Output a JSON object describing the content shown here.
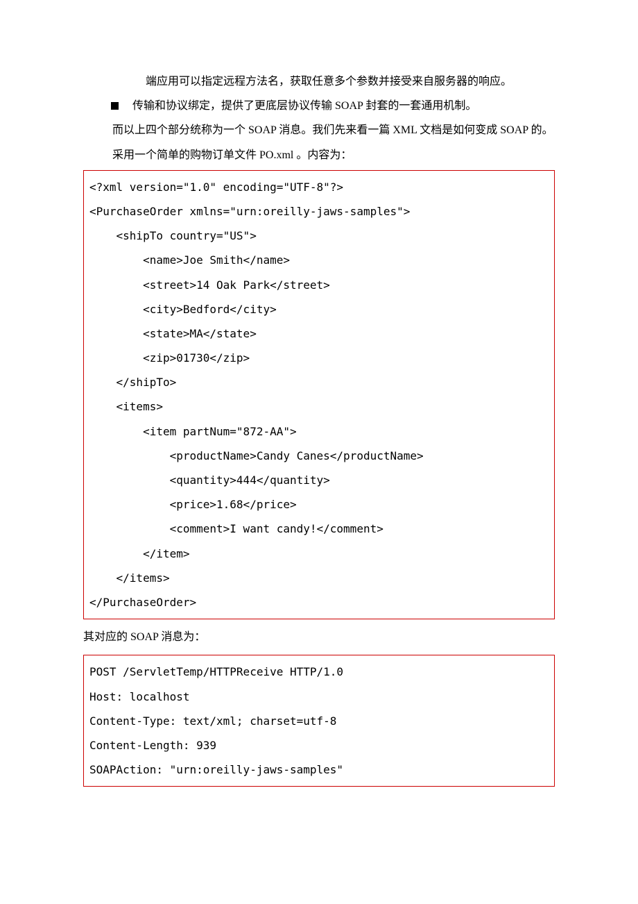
{
  "intro_cont": "端应用可以指定远程方法名，获取任意多个参数并接受来自服务器的响应。",
  "bullet": "传输和协议绑定，提供了更底层协议传输 SOAP 封套的一套通用机制。",
  "para_after_bullet": "而以上四个部分统称为一个 SOAP 消息。我们先来看一篇 XML 文档是如何变成 SOAP 的。采用一个简单的购物订单文件 PO.xml 。内容为：",
  "code1": "<?xml version=\"1.0\" encoding=\"UTF-8\"?>\n<PurchaseOrder xmlns=\"urn:oreilly-jaws-samples\">\n    <shipTo country=\"US\">\n        <name>Joe Smith</name>\n        <street>14 Oak Park</street>\n        <city>Bedford</city>\n        <state>MA</state>\n        <zip>01730</zip>\n    </shipTo>\n    <items>\n        <item partNum=\"872-AA\">\n            <productName>Candy Canes</productName>\n            <quantity>444</quantity>\n            <price>1.68</price>\n            <comment>I want candy!</comment>\n        </item>\n    </items>\n</PurchaseOrder>",
  "caption_between": "其对应的 SOAP 消息为：",
  "code2": "POST /ServletTemp/HTTPReceive HTTP/1.0\nHost: localhost\nContent-Type: text/xml; charset=utf-8\nContent-Length: 939\nSOAPAction: \"urn:oreilly-jaws-samples\""
}
